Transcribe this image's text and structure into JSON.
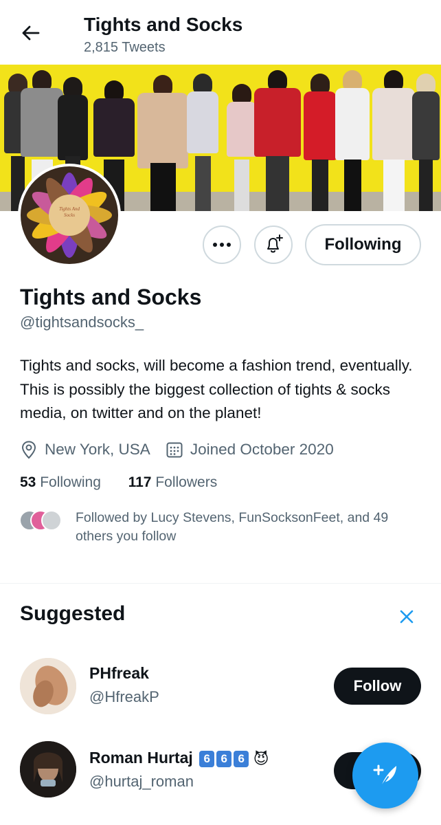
{
  "header": {
    "title": "Tights and Socks",
    "tweet_count": "2,815 Tweets"
  },
  "profile": {
    "name": "Tights and Socks",
    "handle": "@tightsandsocks_",
    "bio": "Tights and socks, will become a fashion trend, eventually. This is possibly the biggest collection of tights & socks media, on twitter and on the planet!",
    "location": "New York, USA",
    "joined": "Joined October 2020",
    "following_count": "53",
    "following_label": "Following",
    "followers_count": "117",
    "followers_label": "Followers",
    "followed_by": "Followed by Lucy Stevens, FunSocksonFeet, and 49 others you follow",
    "avatar_text": "Tights And Socks"
  },
  "actions": {
    "more_icon": "more-horizontal-icon",
    "notify_icon": "bell-plus-icon",
    "following_label": "Following"
  },
  "suggested": {
    "title": "Suggested",
    "items": [
      {
        "name": "PHfreak",
        "handle": "@HfreakP",
        "button": "Follow"
      },
      {
        "name": "Roman Hurtaj",
        "badges": [
          "6",
          "6",
          "6"
        ],
        "emoji": "😈",
        "handle": "@hurtaj_roman",
        "button": "Follow"
      }
    ]
  },
  "colors": {
    "accent": "#1d9bf0",
    "text_primary": "#0f1419",
    "text_secondary": "#536471",
    "banner_bg": "#f2e21a"
  }
}
